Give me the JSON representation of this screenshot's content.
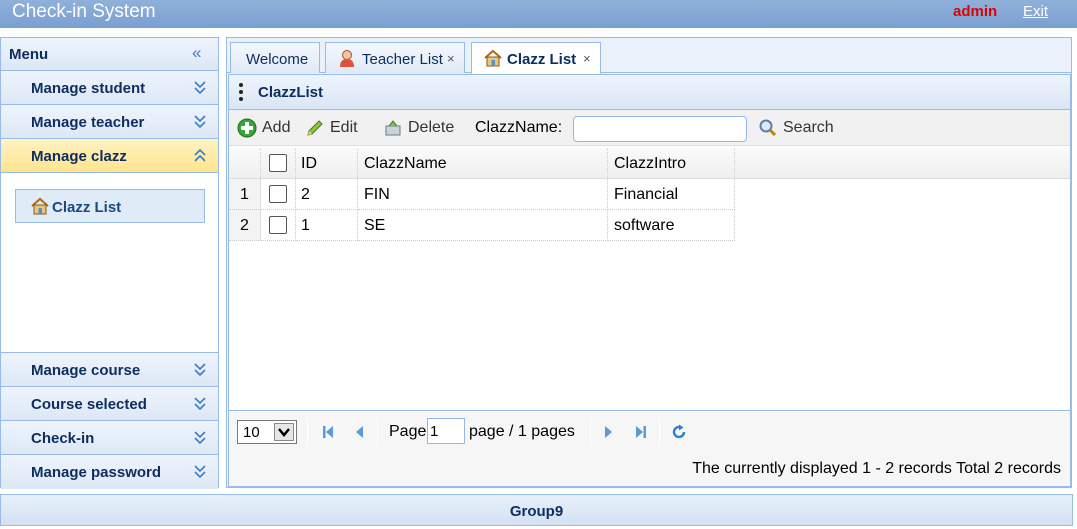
{
  "header": {
    "title": "Check-in System",
    "user": "admin",
    "exit_label": "Exit"
  },
  "sidebar": {
    "title": "Menu",
    "items": [
      {
        "label": "Manage student"
      },
      {
        "label": "Manage teacher"
      },
      {
        "label": "Manage clazz"
      },
      {
        "label": "Manage course"
      },
      {
        "label": "Course selected"
      },
      {
        "label": "Check-in"
      },
      {
        "label": "Manage password"
      }
    ],
    "active_sub_item": "Clazz List"
  },
  "tabs": [
    {
      "label": "Welcome",
      "closable": false
    },
    {
      "label": "Teacher List",
      "closable": true
    },
    {
      "label": "Clazz List",
      "closable": true
    }
  ],
  "close_glyph": "×",
  "panel": {
    "title": "ClazzList"
  },
  "toolbar": {
    "add_label": "Add",
    "edit_label": "Edit",
    "delete_label": "Delete",
    "search_field_label": "ClazzName:",
    "search_value": "",
    "search_label": "Search"
  },
  "table": {
    "columns": [
      "ID",
      "ClazzName",
      "ClazzIntro"
    ],
    "rows": [
      {
        "row_number": "1",
        "id": "2",
        "name": "FIN",
        "intro": "Financial"
      },
      {
        "row_number": "2",
        "id": "1",
        "name": "SE",
        "intro": "software"
      }
    ]
  },
  "pager": {
    "page_size": "10",
    "page_label": "Page",
    "page_value": "1",
    "pages_text": "page / 1 pages",
    "info": "The currently displayed 1 - 2 records Total 2 records"
  },
  "footer": {
    "text": "Group9"
  },
  "colors": {
    "accent": "#99bbe8",
    "header": "#7aa0d2",
    "active_menu": "#ffe48d",
    "admin_text": "#e00000"
  }
}
